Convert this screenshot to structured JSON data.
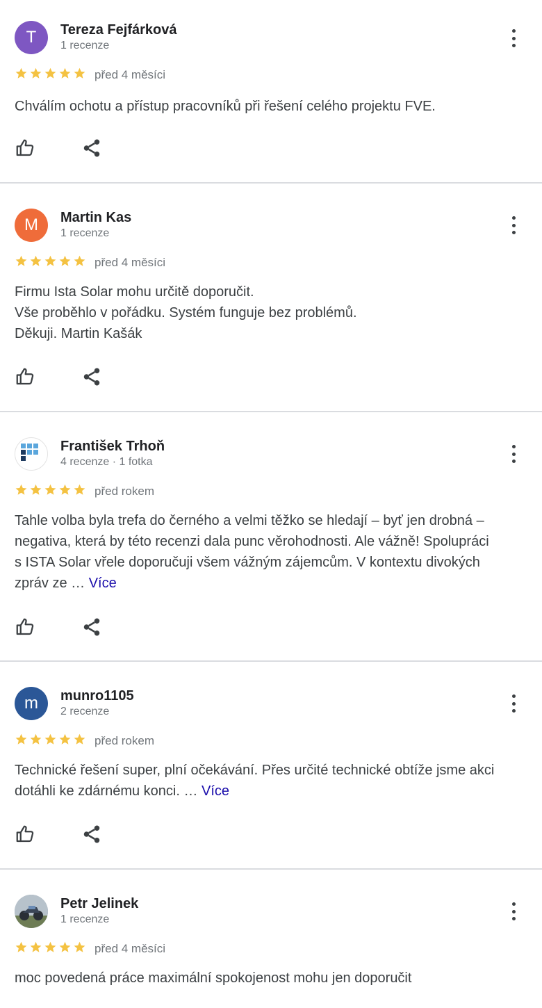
{
  "colors": {
    "star": "#f4c242",
    "link": "#1a0dab",
    "divider": "#dadce0"
  },
  "reviews": [
    {
      "avatar_letter": "T",
      "avatar_color": "#7e57c2",
      "name": "Tereza Fejfárková",
      "meta": "1 recenze",
      "rating": 5,
      "date": "před 4 měsíci",
      "lines": [
        "Chválím ochotu a přístup pracovníků při řešení celého projektu FVE."
      ],
      "more_label": "",
      "icons": {
        "like": "thumbs-up-icon",
        "share": "share-icon",
        "menu": "more-vert-icon"
      }
    },
    {
      "avatar_letter": "M",
      "avatar_color": "#ef6c3a",
      "name": "Martin Kas",
      "meta": "1 recenze",
      "rating": 5,
      "date": "před 4 měsíci",
      "lines": [
        "Firmu Ista Solar mohu určitě doporučit.",
        "Vše proběhlo v pořádku. Systém funguje bez problémů.",
        "Děkuji. Martin Kašák"
      ],
      "more_label": "",
      "icons": {
        "like": "thumbs-up-icon",
        "share": "share-icon",
        "menu": "more-vert-icon"
      }
    },
    {
      "avatar_letter": "",
      "avatar_color": "#ffffff",
      "name": "František Trhoň",
      "meta": "4 recenze · 1 fotka",
      "rating": 5,
      "date": "před rokem",
      "lines": [
        "Tahle volba byla trefa do černého a velmi těžko se hledají – byť jen drobná –",
        "negativa, která by této recenzi dala punc věrohodnosti. Ale vážně! Spolupráci",
        "s ISTA Solar vřele doporučuji všem vážným zájemcům. V kontextu divokých",
        "zpráv ze …"
      ],
      "more_label": "Více",
      "icons": {
        "like": "thumbs-up-icon",
        "share": "share-icon",
        "menu": "more-vert-icon"
      }
    },
    {
      "avatar_letter": "m",
      "avatar_color": "#2b5797",
      "name": "munro1105",
      "meta": "2 recenze",
      "rating": 5,
      "date": "před rokem",
      "lines": [
        "Technické řešení super, plní očekávání. Přes určité technické obtíže jsme akci",
        "dotáhli ke zdárnému konci. …"
      ],
      "more_label": "Více",
      "icons": {
        "like": "thumbs-up-icon",
        "share": "share-icon",
        "menu": "more-vert-icon"
      }
    },
    {
      "avatar_letter": "",
      "avatar_color": "#8a9aa8",
      "name": "Petr Jelinek",
      "meta": "1 recenze",
      "rating": 5,
      "date": "před 4 měsíci",
      "lines": [
        "moc povedená práce maximální spokojenost mohu jen doporučit"
      ],
      "more_label": "",
      "icons": {
        "like": "thumbs-up-icon",
        "share": "share-icon",
        "menu": "more-vert-icon"
      }
    }
  ]
}
